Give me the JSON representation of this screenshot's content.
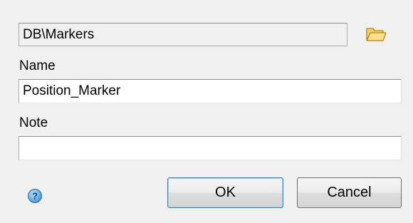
{
  "path_field": {
    "value": "DB\\Markers"
  },
  "fields": {
    "name_label": "Name",
    "name_value": "Position_Marker",
    "note_label": "Note",
    "note_value": ""
  },
  "buttons": {
    "ok_label": "OK",
    "cancel_label": "Cancel"
  },
  "icons": {
    "folder": "folder-open-icon",
    "help": "help-icon"
  },
  "colors": {
    "dialog_bg": "#f0f0f0",
    "folder_yellow": "#e8b838",
    "help_blue": "#3a8fd8",
    "default_button_border": "#3c7fb1"
  }
}
